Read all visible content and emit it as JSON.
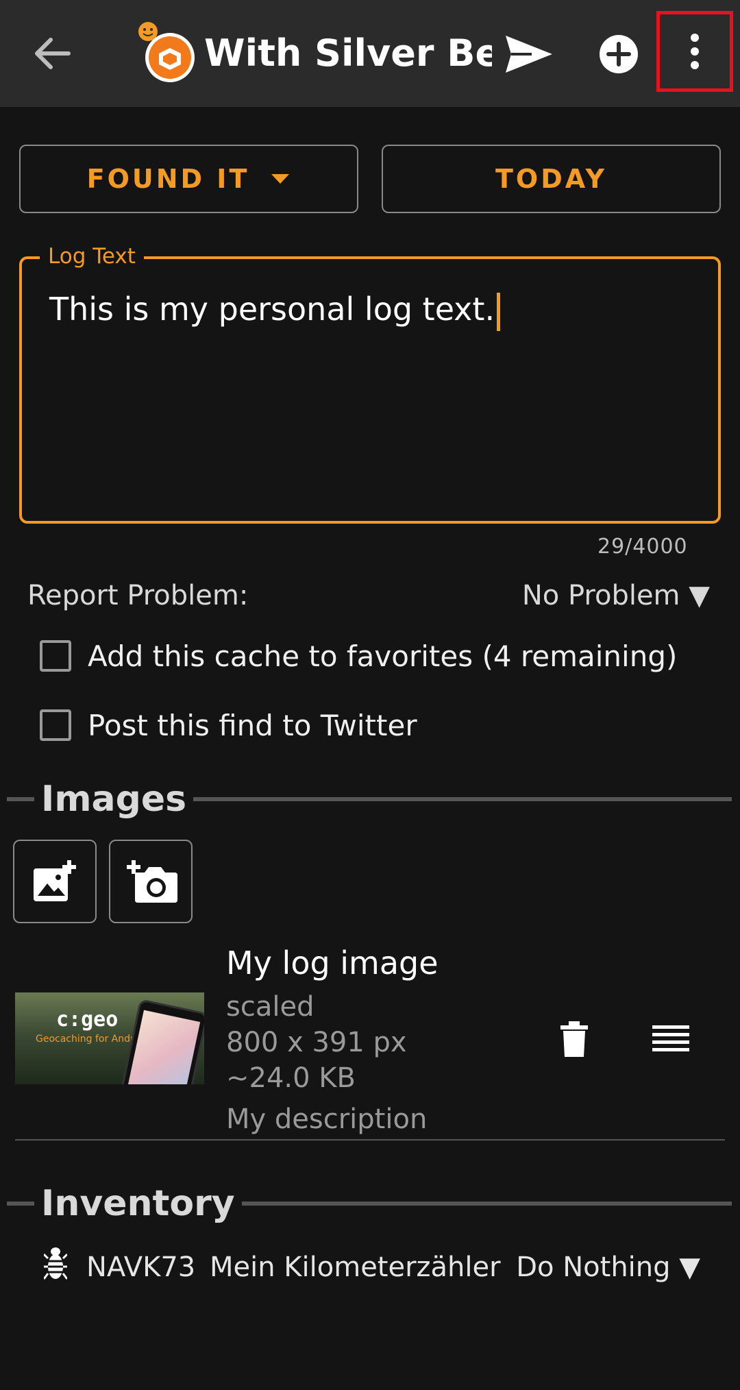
{
  "appbar": {
    "title": "With Silver Be...",
    "icons": [
      "back-arrow-icon",
      "geocache-type-icon",
      "send-icon",
      "add-circle-icon",
      "more-vert-icon"
    ]
  },
  "actions": {
    "log_type": "FOUND IT",
    "date": "TODAY"
  },
  "log": {
    "label": "Log Text",
    "text": "This is my personal log text.",
    "counter": "29/4000"
  },
  "report": {
    "label": "Report Problem:",
    "value": "No Problem ▼"
  },
  "options": {
    "favorite": "Add this cache to favorites (4 remaining)",
    "twitter": "Post this find to Twitter"
  },
  "images": {
    "header": "Images",
    "item": {
      "title": "My log image",
      "scale": "scaled",
      "dimensions": "800 x 391 px",
      "size": "~24.0 KB",
      "description": "My description",
      "thumb_brand": "c:geo",
      "thumb_sub": "Geocaching for Android"
    }
  },
  "inventory": {
    "header": "Inventory",
    "item": {
      "code": "NAVK73",
      "name": "Mein Kilometerzähler",
      "action": "Do Nothing ▼"
    }
  },
  "colors": {
    "accent": "#f59a23",
    "background": "#141414",
    "appbar": "#2b2b2b",
    "highlight": "#e8111d"
  }
}
